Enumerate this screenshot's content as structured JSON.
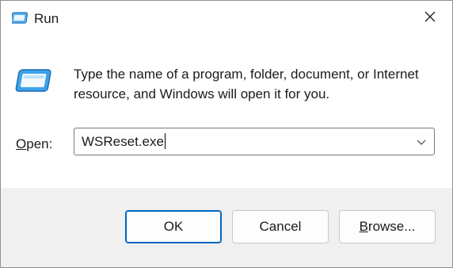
{
  "window": {
    "title": "Run",
    "icon": "run-icon",
    "close_icon": "close-icon"
  },
  "content": {
    "message": "Type the name of a program, folder, document, or Internet resource, and Windows will open it for you.",
    "open_label_mnemonic": "O",
    "open_label_rest": "pen:",
    "open_value": "WSReset.exe",
    "dropdown_icon": "chevron-down-icon"
  },
  "buttons": {
    "ok": "OK",
    "cancel": "Cancel",
    "browse_mnemonic": "B",
    "browse_rest": "rowse..."
  },
  "colors": {
    "accent": "#0067c0",
    "footer_bg": "#f0f0f0",
    "icon_blue": "#2b88d8"
  }
}
